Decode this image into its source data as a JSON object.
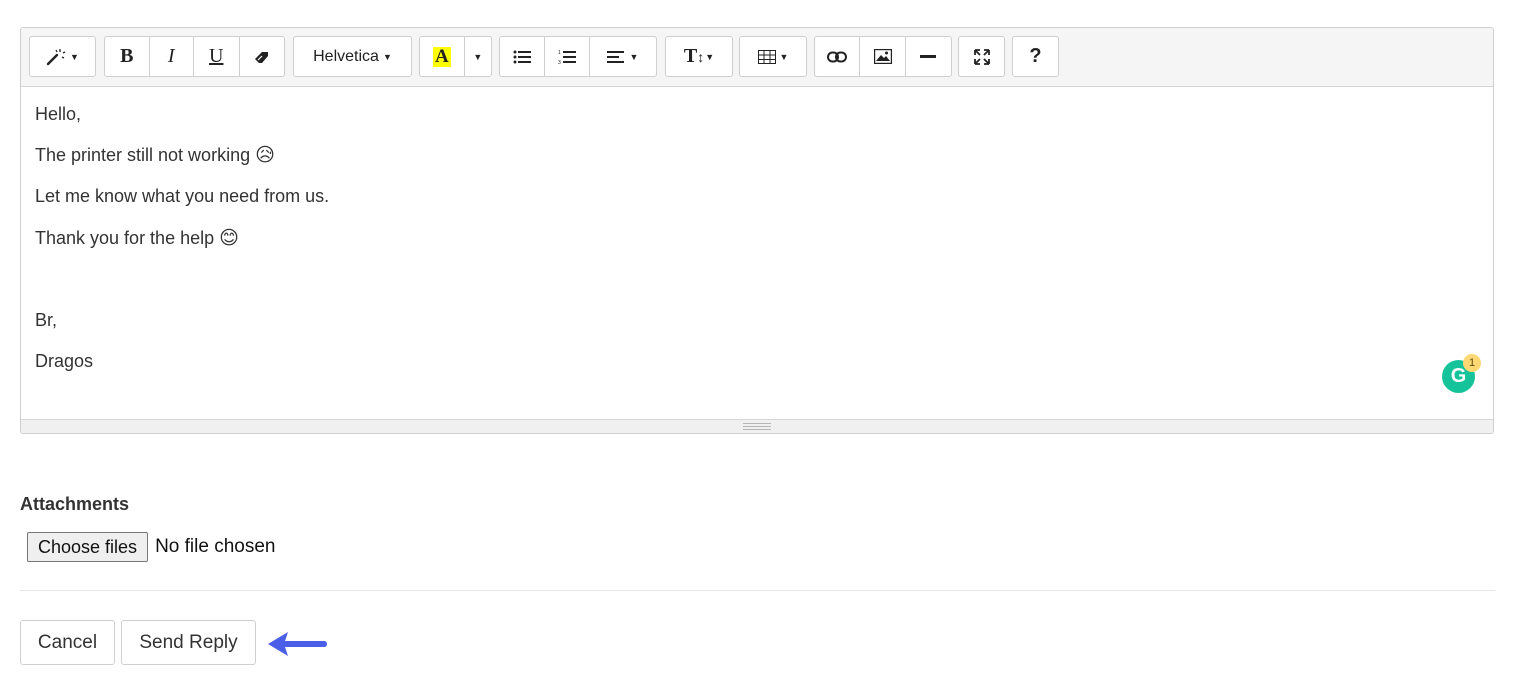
{
  "toolbar": {
    "font_name": "Helvetica",
    "highlight_letter": "A",
    "bold_label": "B",
    "italic_label": "I",
    "underline_label": "U",
    "font_size_label": "T",
    "help_label": "?",
    "highlight_color": "#ffff00",
    "icons": [
      "magic-wand-icon",
      "bold-icon",
      "italic-icon",
      "underline-icon",
      "eraser-icon",
      "font-family-dropdown",
      "highlight-color-icon",
      "chevron-down-icon",
      "unordered-list-icon",
      "ordered-list-icon",
      "align-icon",
      "font-size-icon",
      "table-icon",
      "link-icon",
      "image-icon",
      "horizontal-rule-icon",
      "fullscreen-icon",
      "help-icon"
    ]
  },
  "content": {
    "lines": [
      "Hello,",
      "The printer still not working",
      "Let me know what you need from us.",
      "Thank you for the help",
      "",
      "Br,",
      "Dragos"
    ],
    "emoji_sad": "😥",
    "emoji_smile": "😊"
  },
  "grammarly": {
    "letter": "G",
    "badge_count": "1",
    "color": "#15c39a"
  },
  "attachments": {
    "title": "Attachments",
    "choose_label": "Choose files",
    "status": "No file chosen"
  },
  "actions": {
    "cancel_label": "Cancel",
    "send_label": "Send Reply"
  },
  "annotation": {
    "arrow_color": "#4a5ee8",
    "icon": "arrow-left-icon"
  }
}
